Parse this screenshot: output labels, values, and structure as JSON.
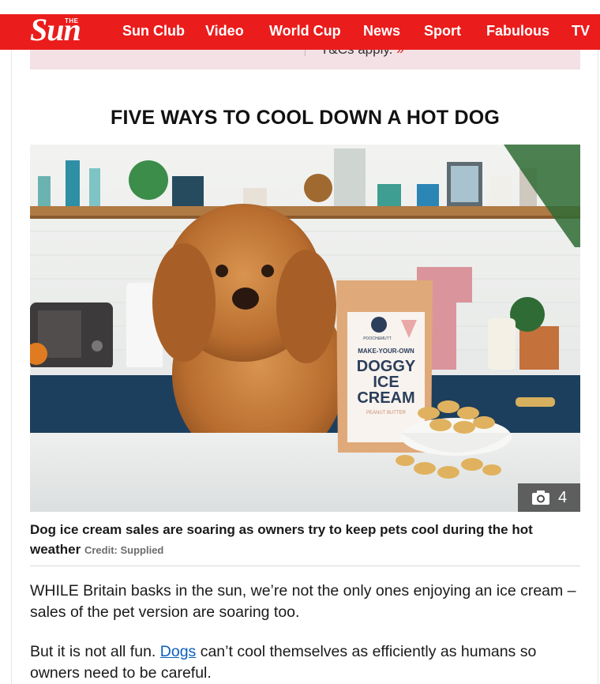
{
  "header": {
    "logo_small": "THE",
    "logo_main": "Sun",
    "nav": [
      "Sun Club",
      "Video",
      "World Cup",
      "News",
      "Sport",
      "Fabulous",
      "TV"
    ]
  },
  "promo": {
    "text": "T&Cs apply.",
    "arrow": "»"
  },
  "article": {
    "headline": "FIVE WAYS TO COOL DOWN A HOT DOG",
    "image": {
      "alt": "Dog beside a pouch of make-your-own doggy ice cream",
      "pouch_text": [
        "MAKE-YOUR-OWN",
        "DOGGY",
        "ICE",
        "CREAM"
      ],
      "pouch_flavour": "PEANUT BUTTER",
      "brand": "POOCH&MUTT",
      "gallery_count": "4",
      "gallery_icon": "camera-icon"
    },
    "caption": "Dog ice cream sales are soaring as owners try to keep pets cool during the hot weather",
    "credit": "Credit: Supplied",
    "paragraph1": "WHILE Britain basks in the sun, we’re not the only ones enjoying an ice cream – sales of the pet version are soaring too.",
    "paragraph2_before": "But it is not all fun. ",
    "paragraph2_link": "Dogs",
    "paragraph2_after": " can’t cool themselves as efficiently as humans so owners need to be careful."
  },
  "colors": {
    "brand_red": "#eb1c1c",
    "promo_bg": "#f3e1e6",
    "link": "#0a5fbd"
  }
}
